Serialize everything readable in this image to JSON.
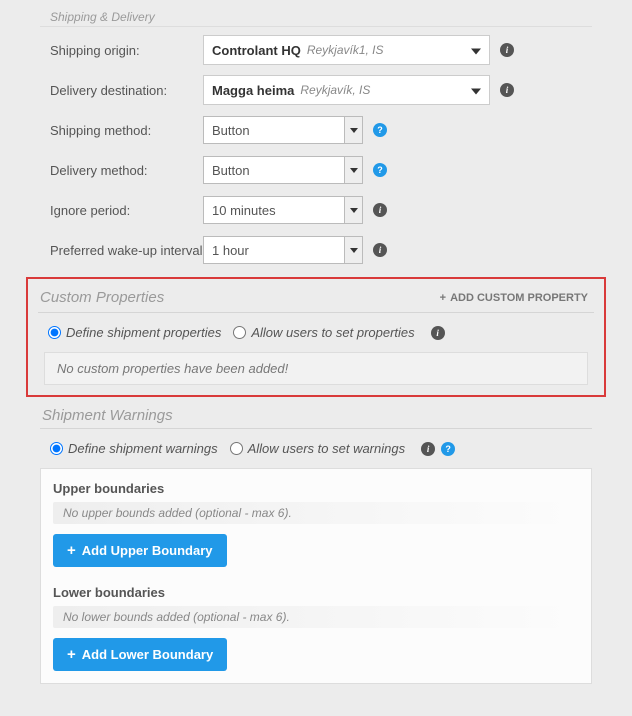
{
  "shipping": {
    "section_title": "Shipping & Delivery",
    "origin_label": "Shipping origin:",
    "origin_value": "Controlant HQ",
    "origin_sub": "Reykjavík1, IS",
    "destination_label": "Delivery destination:",
    "destination_value": "Magga heima",
    "destination_sub": "Reykjavík, IS",
    "method_label": "Shipping method:",
    "method_value": "Button",
    "delivery_method_label": "Delivery method:",
    "delivery_method_value": "Button",
    "ignore_label": "Ignore period:",
    "ignore_value": "10 minutes",
    "wakeup_label": "Preferred wake-up interval",
    "wakeup_value": "1 hour"
  },
  "custom_props": {
    "title": "Custom Properties",
    "add_label": "ADD CUSTOM PROPERTY",
    "radio_define": "Define shipment properties",
    "radio_allow": "Allow users to set properties",
    "empty_msg": "No custom properties have been added!"
  },
  "warnings": {
    "title": "Shipment Warnings",
    "radio_define": "Define shipment warnings",
    "radio_allow": "Allow users to set warnings",
    "upper_title": "Upper boundaries",
    "upper_note": "No upper bounds added (optional - max 6).",
    "upper_btn": "Add Upper Boundary",
    "lower_title": "Lower boundaries",
    "lower_note": "No lower bounds added (optional - max 6).",
    "lower_btn": "Add Lower Boundary"
  }
}
